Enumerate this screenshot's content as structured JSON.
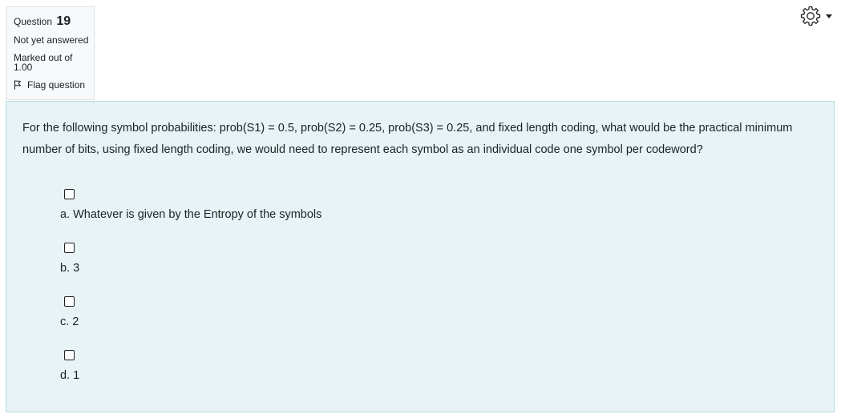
{
  "question_info": {
    "question_label": "Question",
    "question_number": "19",
    "state": "Not yet answered",
    "grade_line1": "Marked out of",
    "grade_line2": "1.00",
    "flag_label": "Flag question"
  },
  "header": {
    "settings_icon": "gear-icon"
  },
  "question": {
    "text": "For the following symbol probabilities: prob(S1) = 0.5,  prob(S2) = 0.25, prob(S3) = 0.25, and fixed length coding, what would be the practical minimum number of bits, using fixed length coding, we would need to represent each symbol as an individual code one symbol per codeword?",
    "options": [
      {
        "label": "a. Whatever is given by the Entropy of the symbols",
        "checked": false
      },
      {
        "label": "b. 3",
        "checked": false
      },
      {
        "label": "c. 2",
        "checked": false
      },
      {
        "label": "d. 1",
        "checked": false
      }
    ]
  }
}
